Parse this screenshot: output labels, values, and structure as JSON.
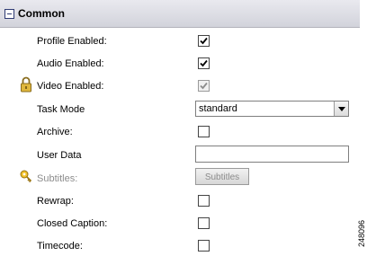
{
  "section": {
    "title": "Common"
  },
  "rows": {
    "profile_enabled": {
      "label": "Profile Enabled:",
      "checked": true
    },
    "audio_enabled": {
      "label": "Audio Enabled:",
      "checked": true
    },
    "video_enabled": {
      "label": "Video Enabled:",
      "checked": true,
      "locked": true
    },
    "task_mode": {
      "label": "Task Mode",
      "value": "standard"
    },
    "archive": {
      "label": "Archive:",
      "checked": false
    },
    "user_data": {
      "label": "User Data",
      "value": ""
    },
    "subtitles": {
      "label": "Subtitles:",
      "button_label": "Subtitles"
    },
    "rewrap": {
      "label": "Rewrap:",
      "checked": false
    },
    "closed_caption": {
      "label": "Closed Caption:",
      "checked": false
    },
    "timecode": {
      "label": "Timecode:",
      "checked": false
    }
  },
  "figure_id": "248096",
  "icons": {
    "collapse": "minus-box-icon",
    "lock": "padlock-icon",
    "key": "key-icon",
    "check": "checkmark-icon",
    "dropdown": "chevron-down-icon"
  }
}
